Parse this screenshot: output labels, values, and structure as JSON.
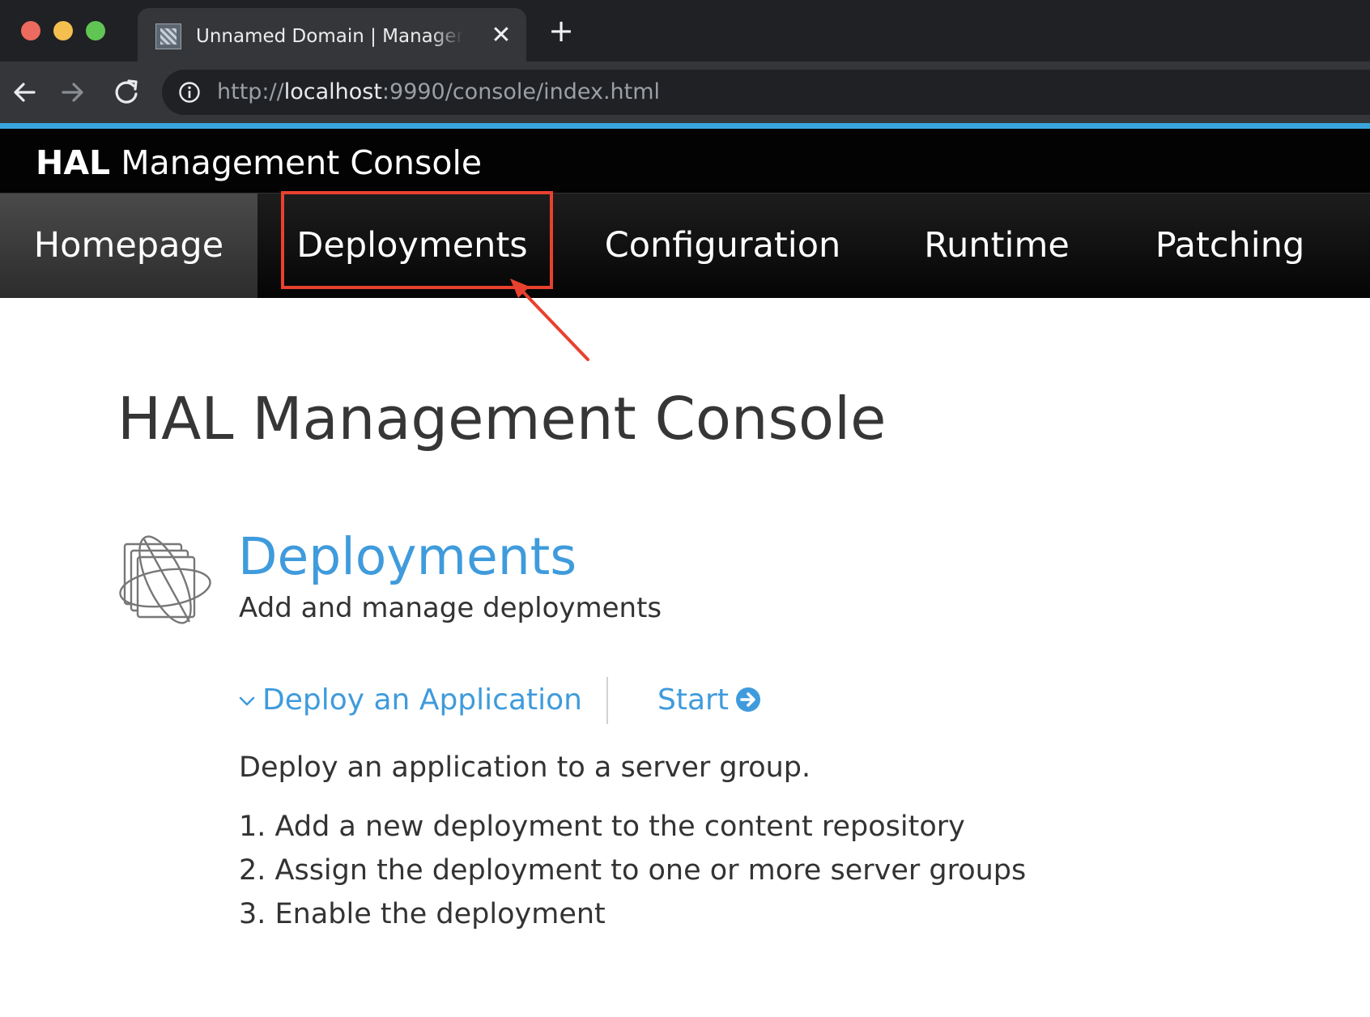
{
  "browser": {
    "tab_title": "Unnamed Domain | Management Console",
    "close_glyph": "✕",
    "new_tab_glyph": "+",
    "url_scheme": "http://",
    "url_host": "localhost",
    "url_rest": ":9990/console/index.html",
    "icons": [
      "back-arrow-icon",
      "forward-arrow-icon",
      "reload-icon",
      "info-icon",
      "close-icon",
      "plus-icon",
      "favicon"
    ]
  },
  "header": {
    "brand_bold": "HAL",
    "brand_rest": "Management Console"
  },
  "nav": {
    "items": [
      {
        "label": "Homepage",
        "active": true
      },
      {
        "label": "Deployments",
        "active": false
      },
      {
        "label": "Configuration",
        "active": false
      },
      {
        "label": "Runtime",
        "active": false
      },
      {
        "label": "Patching",
        "active": false
      }
    ]
  },
  "main": {
    "title": "HAL Management Console",
    "section": {
      "title": "Deployments",
      "subtitle": "Add and manage deployments",
      "icon": "deployments-icon"
    },
    "action": {
      "label": "Deploy an Application",
      "start_label": "Start",
      "description": "Deploy an application to a server group.",
      "steps": [
        "1. Add a new deployment to the content repository",
        "2. Assign the deployment to one or more server groups",
        "3. Enable the deployment"
      ]
    }
  },
  "colors": {
    "accent_line": "#39a5dc",
    "link": "#3f9bdc",
    "annotation": "#e8412f",
    "header_bg": "#030303"
  }
}
